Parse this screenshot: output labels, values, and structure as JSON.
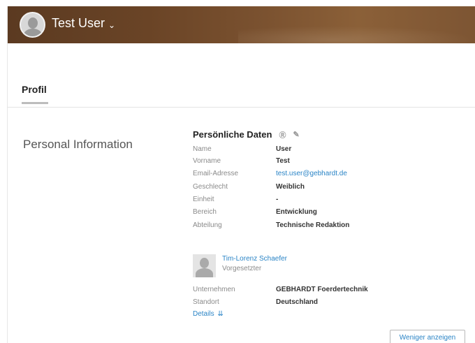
{
  "header": {
    "user_name": "Test User",
    "chevron_icon": "chevron-down-icon"
  },
  "tabs": [
    {
      "label": "Profil",
      "active": true
    }
  ],
  "section": {
    "title": "Personal Information"
  },
  "personal_data": {
    "title": "Persönliche Daten",
    "help_icon": "help-icon",
    "edit_icon": "pencil-icon",
    "fields": [
      {
        "label": "Name",
        "value": "User"
      },
      {
        "label": "Vorname",
        "value": "Test"
      },
      {
        "label": "Email-Adresse",
        "value": "test.user@gebhardt.de",
        "link": true
      },
      {
        "label": "Geschlecht",
        "value": "Weiblich"
      },
      {
        "label": "Einheit",
        "value": "-"
      },
      {
        "label": "Bereich",
        "value": "Entwicklung"
      },
      {
        "label": "Abteilung",
        "value": "Technische Redaktion"
      }
    ],
    "manager": {
      "name": "Tim-Lorenz Schaefer",
      "role": "Vorgesetzter"
    },
    "extra_fields": [
      {
        "label": "Unternehmen",
        "value": "GEBHARDT Foerdertechnik"
      },
      {
        "label": "Standort",
        "value": "Deutschland"
      }
    ],
    "details_label": "Details",
    "details_icon": "double-chevron-down-icon"
  },
  "buttons": {
    "show_less": "Weniger anzeigen"
  },
  "colors": {
    "banner": "#6a4426",
    "link": "#2a84c6"
  }
}
